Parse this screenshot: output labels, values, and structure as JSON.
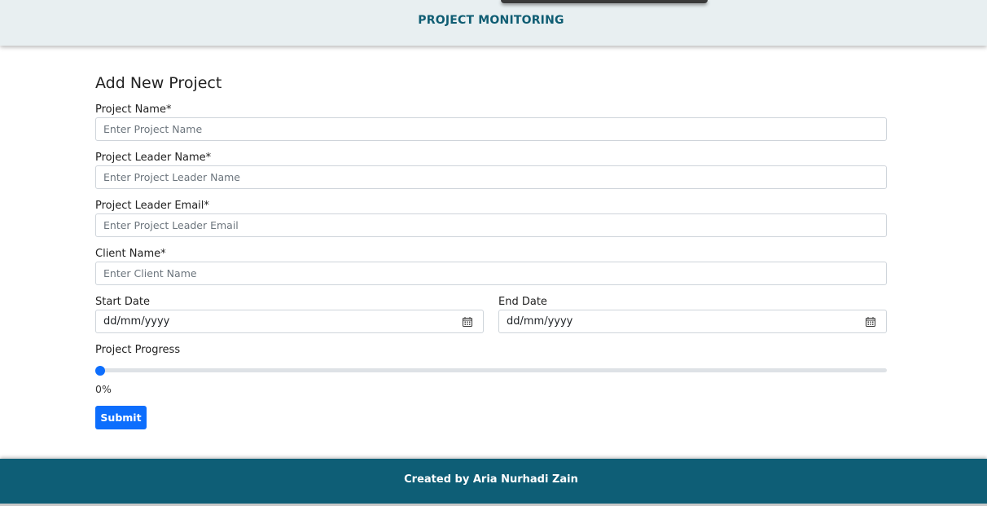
{
  "header": {
    "title": "PROJECT MONITORING"
  },
  "form": {
    "title": "Add New Project",
    "project_name": {
      "label": "Project Name*",
      "placeholder": "Enter Project Name",
      "value": ""
    },
    "leader_name": {
      "label": "Project Leader Name*",
      "placeholder": "Enter Project Leader Name",
      "value": ""
    },
    "leader_email": {
      "label": "Project Leader Email*",
      "placeholder": "Enter Project Leader Email",
      "value": ""
    },
    "client_name": {
      "label": "Client Name*",
      "placeholder": "Enter Client Name",
      "value": ""
    },
    "start_date": {
      "label": "Start Date",
      "value": "dd/mm/yyyy",
      "icon": "calendar-icon"
    },
    "end_date": {
      "label": "End Date",
      "value": "dd/mm/yyyy",
      "icon": "calendar-icon"
    },
    "progress": {
      "label": "Project Progress",
      "value": 0,
      "display": "0%"
    },
    "submit_label": "Submit"
  },
  "footer": {
    "text": "Created by Aria Nurhadi Zain"
  },
  "colors": {
    "header_bg": "#e8eff1",
    "header_text": "#0f5d73",
    "accent": "#0d6efd",
    "footer_bg": "#0e5e76"
  }
}
